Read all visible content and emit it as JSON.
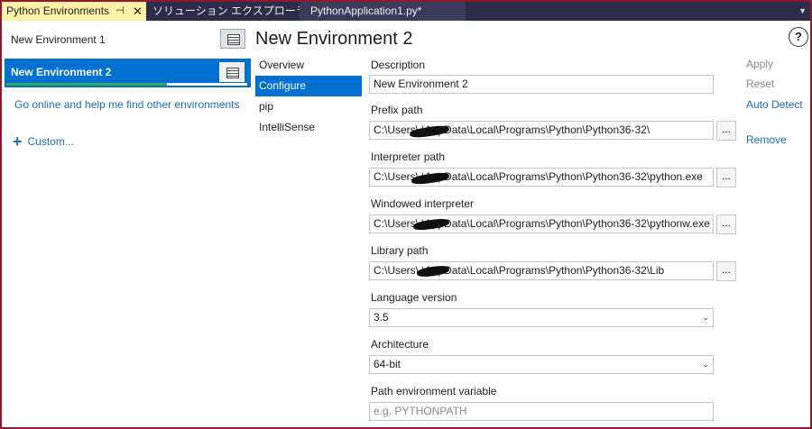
{
  "tabs": {
    "active": "Python Environments",
    "pin_glyph": "⊣",
    "close_glyph": "✕",
    "second": "ソリューション エクスプローラー",
    "third": "PythonApplication1.py*",
    "dropdown_glyph": "▼"
  },
  "environments": [
    {
      "name": "New Environment 1",
      "icon": "environment-window-icon",
      "selected": false
    },
    {
      "name": "New Environment 2",
      "icon": "environment-window-icon",
      "selected": true
    }
  ],
  "links": {
    "online": "Go online and help me find other environments",
    "custom_plus": "+",
    "custom": "Custom..."
  },
  "page_title": "New Environment 2",
  "help_glyph": "?",
  "nav": {
    "items": [
      "Overview",
      "Configure",
      "pip",
      "IntelliSense"
    ],
    "active": "Configure"
  },
  "form": {
    "description": {
      "label": "Description",
      "value": "New Environment 2"
    },
    "prefix_path": {
      "label": "Prefix path",
      "value": "C:\\Users\\          \\AppData\\Local\\Programs\\Python\\Python36-32\\"
    },
    "interpreter_path": {
      "label": "Interpreter path",
      "value": "C:\\Users\\          \\AppData\\Local\\Programs\\Python\\Python36-32\\python.exe"
    },
    "windowed_interpreter": {
      "label": "Windowed interpreter",
      "value": "C:\\Users\\          \\AppData\\Local\\Programs\\Python\\Python36-32\\pythonw.exe"
    },
    "library_path": {
      "label": "Library path",
      "value": "C:\\Users\\          \\AppData\\Local\\Programs\\Python\\Python36-32\\Lib"
    },
    "language_version": {
      "label": "Language version",
      "value": "3.5"
    },
    "architecture": {
      "label": "Architecture",
      "value": "64-bit"
    },
    "path_env_var": {
      "label": "Path environment variable",
      "placeholder": "e.g. PYTHONPATH"
    },
    "browse_label": "...",
    "select_arrow": "⌄"
  },
  "actions": {
    "apply": "Apply",
    "reset": "Reset",
    "auto_detect": "Auto Detect",
    "remove": "Remove"
  },
  "colors": {
    "accent": "#0070d1",
    "link": "#1e6fbf",
    "active_tab": "#fff1a8",
    "tab_strip": "#2d2d4b",
    "window_border": "#8b1a2c",
    "progress": "#2fae5a"
  }
}
